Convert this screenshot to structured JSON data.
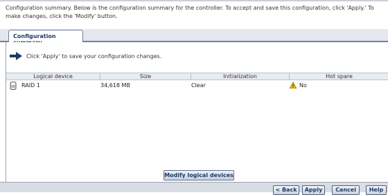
{
  "header": {
    "text": "Configuration summary. Below is the configuration summary for the controller. To accept and save this configuration, click 'Apply.' To make changes, click the 'Modify' button."
  },
  "tabs": [
    {
      "label": "Configuration summary",
      "selected": true
    }
  ],
  "instruction": {
    "icon": "arrow-right-icon",
    "text": "Click 'Apply' to save your configuration changes."
  },
  "table": {
    "columns": [
      "Logical device",
      "Size",
      "Initialization",
      "Hot spare"
    ],
    "rows": [
      {
        "icon": "drive-icon",
        "logical_device": "RAID 1",
        "size": "34,618 MB",
        "initialization": "Clear",
        "hot_spare_icon": "warning-icon",
        "hot_spare": "No"
      }
    ]
  },
  "buttons": {
    "modify": "Modify logical devices",
    "back": "< Back",
    "apply": "Apply",
    "cancel": "Cancel",
    "help": "Help"
  },
  "colors": {
    "accent": "#1b3a68",
    "border": "#6d7f9c",
    "warning": "#f2c200"
  }
}
